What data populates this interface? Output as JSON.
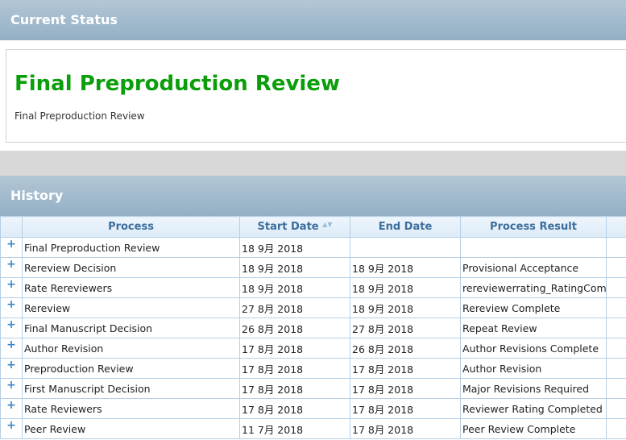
{
  "current_status": {
    "header": "Current Status",
    "title": "Final Preproduction Review",
    "subtitle": "Final Preproduction Review"
  },
  "history": {
    "header": "History",
    "columns": [
      "Process",
      "Start Date",
      "End Date",
      "Process Result"
    ],
    "rows": [
      [
        "Final Preproduction Review",
        "18 9月 2018",
        "",
        ""
      ],
      [
        "Rereview Decision",
        "18 9月 2018",
        "18 9月 2018",
        "Provisional Acceptance"
      ],
      [
        "Rate Rereviewers",
        "18 9月 2018",
        "18 9月 2018",
        "rereviewerrating_RatingCompleted"
      ],
      [
        "Rereview",
        "27 8月 2018",
        "18 9月 2018",
        "Rereview Complete"
      ],
      [
        "Final Manuscript Decision",
        "26 8月 2018",
        "27 8月 2018",
        "Repeat Review"
      ],
      [
        "Author Revision",
        "17 8月 2018",
        "26 8月 2018",
        "Author Revisions Complete"
      ],
      [
        "Preproduction Review",
        "17 8月 2018",
        "17 8月 2018",
        "Author Revision"
      ],
      [
        "First Manuscript Decision",
        "17 8月 2018",
        "17 8月 2018",
        "Major Revisions Required"
      ],
      [
        "Rate Reviewers",
        "17 8月 2018",
        "17 8月 2018",
        "Reviewer Rating Completed"
      ],
      [
        "Peer Review",
        "11 7月 2018",
        "17 8月 2018",
        "Peer Review Complete"
      ]
    ]
  }
}
